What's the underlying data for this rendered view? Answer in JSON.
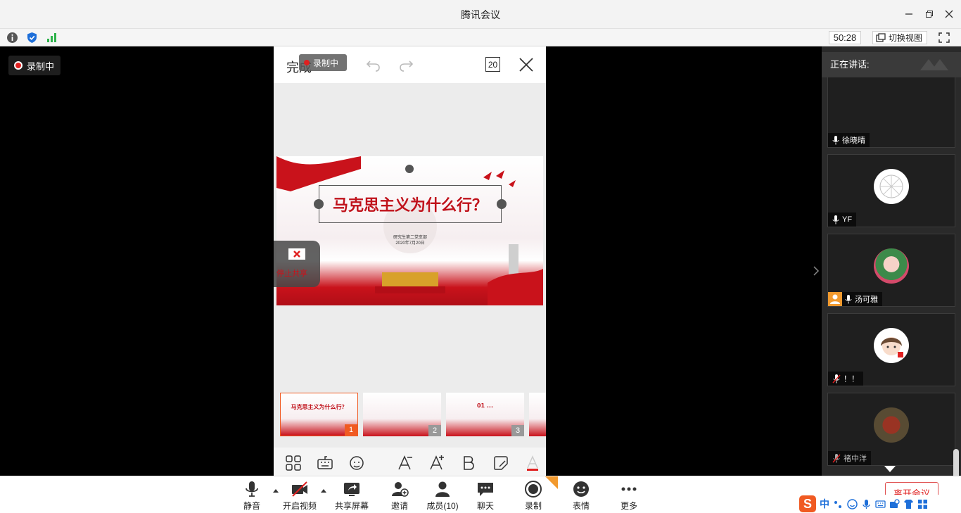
{
  "window": {
    "title": "腾讯会议"
  },
  "infobar": {
    "timer": "50:28",
    "switch_view": "切换视图"
  },
  "stage": {
    "recording_label": "录制中"
  },
  "phone": {
    "done_label": "完成",
    "recording_pill": "录制中",
    "page_count": "20",
    "slide": {
      "title": "马克思主义为什么行？",
      "sub_line1": "研究生第二党支部",
      "sub_line2": "2020年7月20日"
    },
    "thumbnails": [
      {
        "num": "1",
        "text": "马克思主义为什么行？"
      },
      {
        "num": "2",
        "text": ""
      },
      {
        "num": "3",
        "text": "01 ..."
      }
    ],
    "stop_share_label": "停止共享"
  },
  "panel": {
    "speaking_label": "正在讲话:",
    "participants": [
      {
        "name": "徐晓晴"
      },
      {
        "name": "YF"
      },
      {
        "name": "汤可雅"
      },
      {
        "name": "！！"
      },
      {
        "name": "褚中洋"
      }
    ]
  },
  "toolbar": {
    "mute": "静音",
    "video": "开启视频",
    "share": "共享屏幕",
    "invite": "邀请",
    "members": "成员(10)",
    "chat": "聊天",
    "record": "录制",
    "emoji": "表情",
    "more": "更多",
    "leave": "离开会议"
  },
  "ime": {
    "lang": "中"
  },
  "colors": {
    "accent_red": "#e02020",
    "brand_blue": "#1e6fd9",
    "slide_red": "#c0121b"
  }
}
